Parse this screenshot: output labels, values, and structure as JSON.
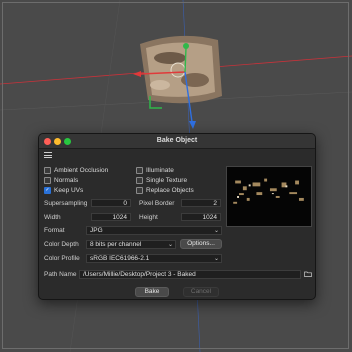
{
  "dialog": {
    "title": "Bake Object",
    "checkboxes": {
      "ambient_occlusion": {
        "label": "Ambient Occlusion",
        "checked": false
      },
      "normals": {
        "label": "Normals",
        "checked": false
      },
      "keep_uvs": {
        "label": "Keep UVs",
        "checked": true
      },
      "illuminate": {
        "label": "Illuminate",
        "checked": false
      },
      "single_texture": {
        "label": "Single Texture",
        "checked": false
      },
      "replace_objects": {
        "label": "Replace Objects",
        "checked": false
      }
    },
    "fields": {
      "supersampling": {
        "label": "Supersampling",
        "value": "0"
      },
      "pixel_border": {
        "label": "Pixel Border",
        "value": "2"
      },
      "width": {
        "label": "Width",
        "value": "1024"
      },
      "height": {
        "label": "Height",
        "value": "1024"
      }
    },
    "format": {
      "label": "Format",
      "value": "JPG"
    },
    "color_depth": {
      "label": "Color Depth",
      "value": "8 bits per channel",
      "options_button": "Options..."
    },
    "color_profile": {
      "label": "Color Profile",
      "value": "sRGB IEC61966-2.1"
    },
    "path_name": {
      "label": "Path Name",
      "value": "/Users/Millie/Desktop/Project 3 - Baked"
    },
    "buttons": {
      "bake": "Bake",
      "cancel": "Cancel"
    }
  },
  "colors": {
    "accent": "#2a72d9",
    "axis_red": "#c8323a",
    "axis_green": "#2fb84a",
    "axis_blue": "#2f6fe0"
  }
}
